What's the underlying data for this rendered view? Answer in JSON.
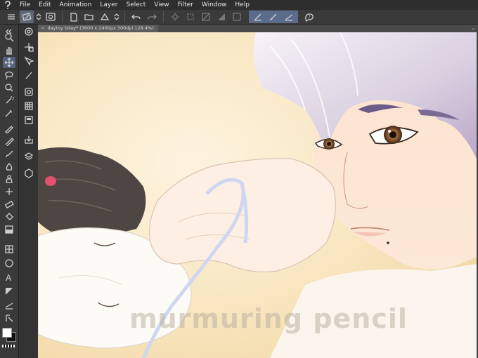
{
  "app": {
    "logo_icon": "clip-studio-logo-icon"
  },
  "menu": {
    "items": [
      "File",
      "Edit",
      "Animation",
      "Layer",
      "Select",
      "View",
      "Filter",
      "Window",
      "Help"
    ]
  },
  "toolbar": {
    "icons": [
      "hamburger-icon",
      "rotate-canvas-icon",
      "chevron-updown-icon",
      "view-settings-icon",
      "new-file-icon",
      "open-file-icon",
      "save-icon",
      "undo-icon",
      "redo-icon",
      "transform-icon",
      "crop-icon",
      "fill-icon",
      "eraser-icon",
      "pen-tool-icon",
      "brush-tool-icon",
      "ruler-tool-icon",
      "question-icon"
    ]
  },
  "document": {
    "tab_label": "daytoy bday* (3600 x 2400px 300dpi 128.4%)"
  },
  "canvas": {
    "watermark": "murmuring pencil"
  },
  "colors": {
    "foreground": "#ffffff",
    "background": "#111111",
    "accent": "#5a6b8c"
  }
}
